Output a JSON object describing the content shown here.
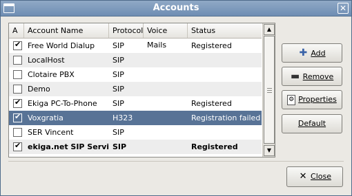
{
  "window": {
    "title": "Accounts",
    "close_glyph": "✕",
    "menu_icon": "window-menu-icon"
  },
  "table": {
    "columns": [
      "A",
      "Account Name",
      "Protocol",
      "Voice Mails",
      "Status"
    ],
    "rows": [
      {
        "enabled": true,
        "name": "Free World Dialup",
        "protocol": "SIP",
        "voicemails": "",
        "status": "Registered"
      },
      {
        "enabled": false,
        "name": "LocalHost",
        "protocol": "SIP",
        "voicemails": "",
        "status": ""
      },
      {
        "enabled": false,
        "name": "Clotaire PBX",
        "protocol": "SIP",
        "voicemails": "",
        "status": ""
      },
      {
        "enabled": false,
        "name": "Demo",
        "protocol": "SIP",
        "voicemails": "",
        "status": ""
      },
      {
        "enabled": true,
        "name": "Ekiga PC-To-Phone",
        "protocol": "SIP",
        "voicemails": "",
        "status": "Registered"
      },
      {
        "enabled": true,
        "name": "Voxgratia",
        "protocol": "H323",
        "voicemails": "",
        "status": "Registration failed",
        "selected": true
      },
      {
        "enabled": false,
        "name": "SER Vincent",
        "protocol": "SIP",
        "voicemails": "",
        "status": ""
      },
      {
        "enabled": true,
        "name": "ekiga.net SIP Service",
        "protocol": "SIP",
        "voicemails": "",
        "status": "Registered",
        "bold": true
      }
    ]
  },
  "buttons": {
    "add": "Add",
    "remove": "Remove",
    "properties": "Properties",
    "default": "Default",
    "close": "Close"
  },
  "colors": {
    "titlebar": "#7f9bbd",
    "selection": "#587396"
  }
}
